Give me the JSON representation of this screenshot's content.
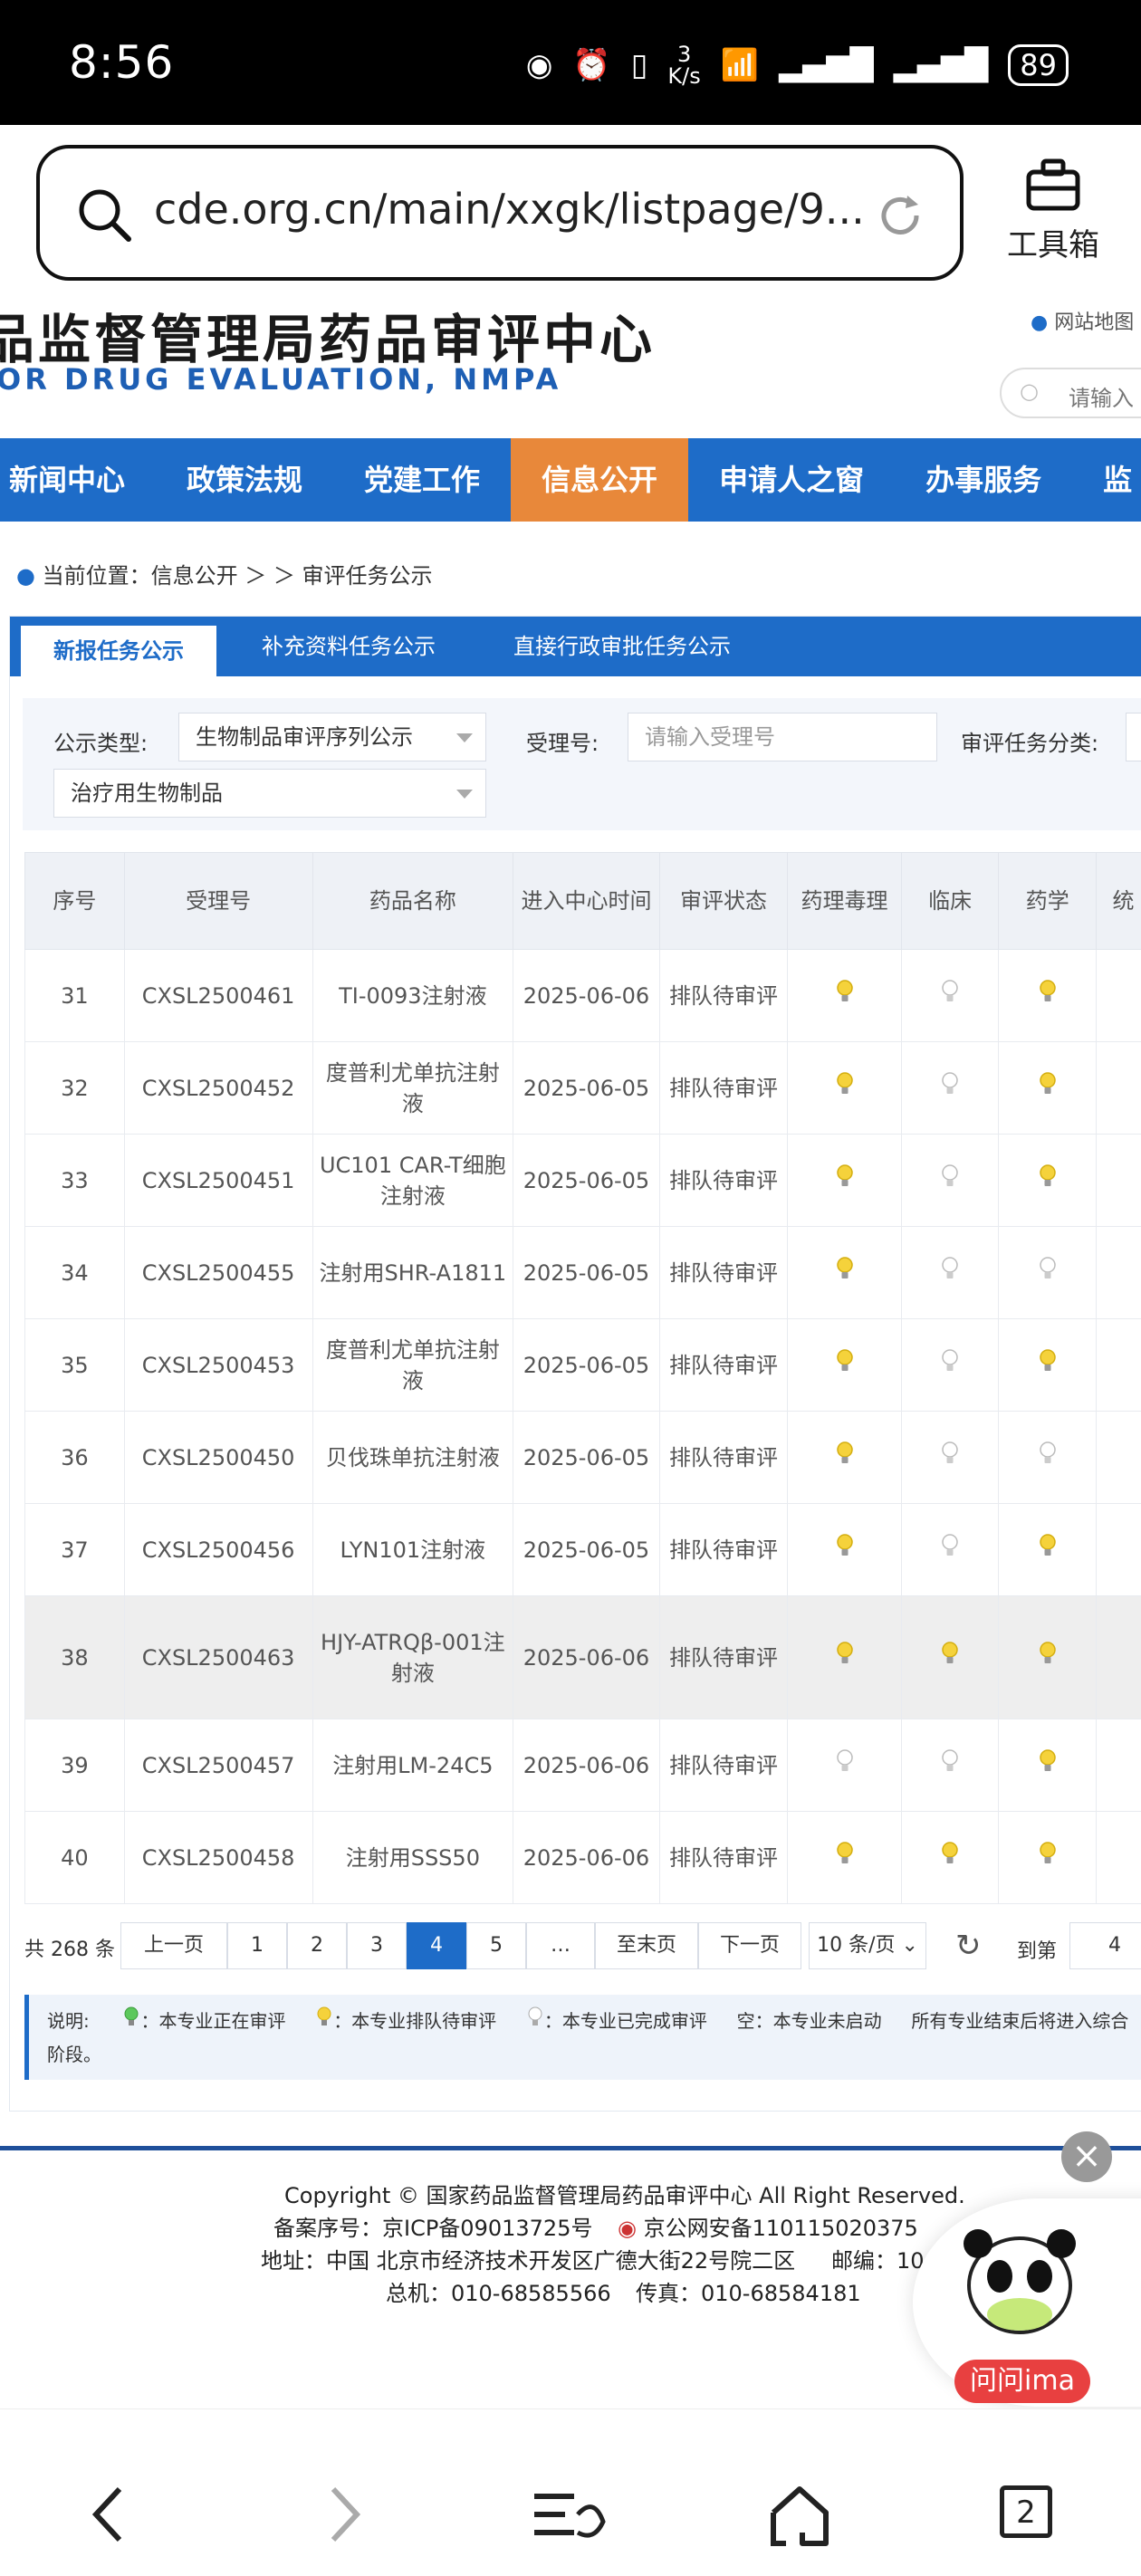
{
  "status": {
    "time": "8:56",
    "speed_top": "3",
    "speed_unit": "K/s",
    "battery": "89"
  },
  "browser": {
    "url": "cde.org.cn/main/xxgk/listpage/9...",
    "toolbox_label": "工具箱"
  },
  "site": {
    "title_cn": "品监督管理局药品审评中心",
    "title_en": "OR DRUG EVALUATION, NMPA",
    "sitemap": "网站地图",
    "search_placeholder": "请输入"
  },
  "nav": [
    "新闻中心",
    "政策法规",
    "党建工作",
    "信息公开",
    "申请人之窗",
    "办事服务",
    "监"
  ],
  "breadcrumb": "当前位置：信息公开 ＞ ＞ 审评任务公示",
  "tabs": [
    "新报任务公示",
    "补充资料任务公示",
    "直接行政审批任务公示"
  ],
  "filters": {
    "type_label": "公示类型:",
    "type_value": "生物制品审评序列公示",
    "accept_label": "受理号:",
    "accept_placeholder": "请输入受理号",
    "category_label": "审评任务分类:",
    "subtype_value": "治疗用生物制品"
  },
  "table": {
    "headers": [
      "序号",
      "受理号",
      "药品名称",
      "进入中心时间",
      "审评状态",
      "药理毒理",
      "临床",
      "药学",
      "统"
    ],
    "rows": [
      {
        "no": "31",
        "accept": "CXSL2500461",
        "name": "TI-0093注射液",
        "date": "2025-06-06",
        "status": "排队待审评",
        "b": [
          "yellow",
          "white",
          "yellow"
        ]
      },
      {
        "no": "32",
        "accept": "CXSL2500452",
        "name": "度普利尤单抗注射液",
        "date": "2025-06-05",
        "status": "排队待审评",
        "b": [
          "yellow",
          "white",
          "yellow"
        ]
      },
      {
        "no": "33",
        "accept": "CXSL2500451",
        "name": "UC101 CAR-T细胞注射液",
        "date": "2025-06-05",
        "status": "排队待审评",
        "b": [
          "yellow",
          "white",
          "yellow"
        ]
      },
      {
        "no": "34",
        "accept": "CXSL2500455",
        "name": "注射用SHR-A1811",
        "date": "2025-06-05",
        "status": "排队待审评",
        "b": [
          "yellow",
          "white",
          "white"
        ]
      },
      {
        "no": "35",
        "accept": "CXSL2500453",
        "name": "度普利尤单抗注射液",
        "date": "2025-06-05",
        "status": "排队待审评",
        "b": [
          "yellow",
          "white",
          "yellow"
        ]
      },
      {
        "no": "36",
        "accept": "CXSL2500450",
        "name": "贝伐珠单抗注射液",
        "date": "2025-06-05",
        "status": "排队待审评",
        "b": [
          "yellow",
          "white",
          "white"
        ]
      },
      {
        "no": "37",
        "accept": "CXSL2500456",
        "name": "LYN101注射液",
        "date": "2025-06-05",
        "status": "排队待审评",
        "b": [
          "yellow",
          "white",
          "yellow"
        ]
      },
      {
        "no": "38",
        "accept": "CXSL2500463",
        "name": "HJY-ATRQβ-001注射液",
        "date": "2025-06-06",
        "status": "排队待审评",
        "b": [
          "yellow",
          "yellow",
          "yellow"
        ]
      },
      {
        "no": "39",
        "accept": "CXSL2500457",
        "name": "注射用LM-24C5",
        "date": "2025-06-06",
        "status": "排队待审评",
        "b": [
          "white",
          "white",
          "yellow"
        ]
      },
      {
        "no": "40",
        "accept": "CXSL2500458",
        "name": "注射用SSS50",
        "date": "2025-06-06",
        "status": "排队待审评",
        "b": [
          "yellow",
          "yellow",
          "yellow"
        ]
      }
    ]
  },
  "pagination": {
    "total": "共 268 条",
    "prev": "上一页",
    "pages": [
      "1",
      "2",
      "3",
      "4",
      "5",
      "…"
    ],
    "last": "至末页",
    "next": "下一页",
    "size": "10 条/页",
    "goto": "到第",
    "goto_value": "4"
  },
  "legend": {
    "prefix": "说明:",
    "green": "：本专业正在审评",
    "yellow": "：本专业排队待审评",
    "white": "：本专业已完成审评",
    "empty": "空：本专业未启动",
    "tail": "所有专业结束后将进入综合",
    "line2": "阶段。"
  },
  "footer": {
    "copyright": "Copyright © 国家药品监督管理局药品审评中心    All Right Reserved.",
    "icp": "备案序号：京ICP备09013725号",
    "police": "京公网安备110115020375",
    "address": "地址：中国 北京市经济技术开发区广德大街22号院二区",
    "postcode": "邮编：10",
    "phone": "总机：010-68585566",
    "fax": "传真：010-68584181"
  },
  "ima": {
    "label": "问问ima"
  },
  "bottom": {
    "tabs_count": "2"
  },
  "colors": {
    "brand": "#1e6cc8",
    "active_nav": "#e8883a",
    "bulb_yellow": "#f5d23b",
    "bulb_green": "#5cc85c"
  }
}
